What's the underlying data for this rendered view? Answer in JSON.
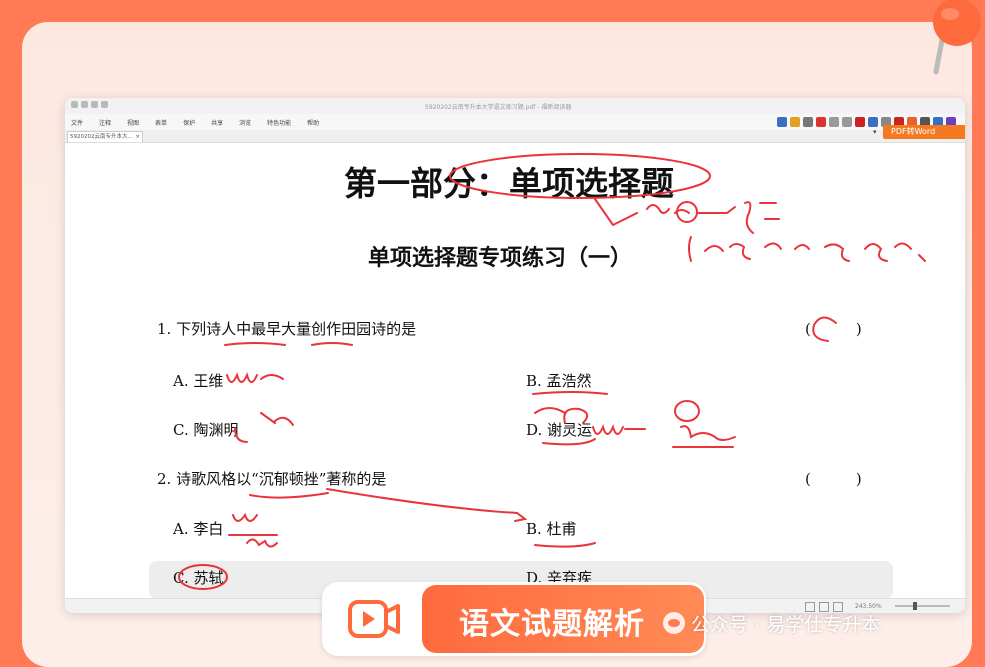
{
  "app": {
    "window_title": "5920202云南专升本大学语文练习题.pdf - 福昕阅读器",
    "menu": [
      "文件",
      "注释",
      "视图",
      "表单",
      "保护",
      "共享",
      "浏览",
      "特色功能",
      "帮助"
    ],
    "tab_label": "5920202云南专升本大...",
    "tab_close": "×",
    "pdf_to_word": "PDF转Word",
    "zoom": "243.50%"
  },
  "document": {
    "heading": "第一部分：单项选择题",
    "subheading": "单项选择题专项练习（一）",
    "questions": [
      {
        "stem": "1. 下列诗人中最早大量创作田园诗的是",
        "paren": "(　　　)",
        "options": [
          "A. 王维",
          "B. 孟浩然",
          "C. 陶渊明",
          "D. 谢灵运"
        ]
      },
      {
        "stem": "2. 诗歌风格以“沉郁顿挫”著称的是",
        "paren": "(　　　)",
        "options": [
          "A. 李白",
          "B. 杜甫",
          "C. 苏轼",
          "D. 辛弃疾"
        ]
      }
    ]
  },
  "banner": {
    "label": "语文试题解析"
  },
  "watermark": {
    "text": "公众号 · 易学仕专升本"
  },
  "colors": {
    "accent": "#ff7a55",
    "ink": "#e8343a",
    "pdf_button": "#f47a22"
  }
}
